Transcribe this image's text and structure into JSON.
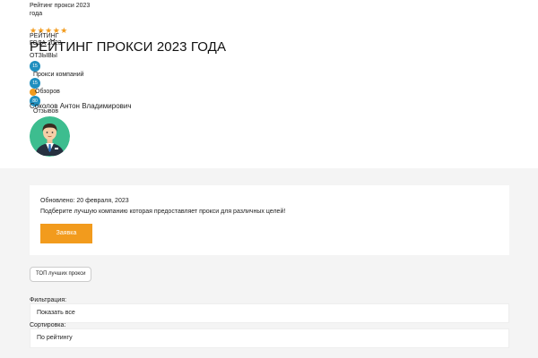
{
  "topbar": {
    "title": "Рейтинг прокси 2023 года"
  },
  "hero": {
    "stars": "★★★★★",
    "rating_label": "РЕЙТИНГ ГОДА 2023",
    "reviews_label": "ОТЗЫВЫ",
    "page_title": "РЕЙТИНГ ПРОКСИ 2023 ГОДА",
    "stats": [
      {
        "count": "15",
        "label": "Прокси компаний"
      },
      {
        "count": "15",
        "label": "Обзоров"
      },
      {
        "count": "80",
        "label": "Отзывов"
      }
    ],
    "author": "Соколов Антон Владимирович"
  },
  "card": {
    "updated": "Обновлено: 20 февраля, 2023",
    "subtitle": "Подберите лучшую компанию которая предоставляет прокси для различных целей!",
    "button": "Заявка"
  },
  "tag": "ТОП лучших прокси",
  "filters": {
    "filter_label": "Фильтрация:",
    "filter_value": "Показать все",
    "sort_label": "Сортировка:",
    "sort_value": "По рейтингу"
  },
  "colors": {
    "accent": "#f29b1d",
    "blue": "#1f8fbf",
    "avatar_bg": "#3dbd8f"
  }
}
